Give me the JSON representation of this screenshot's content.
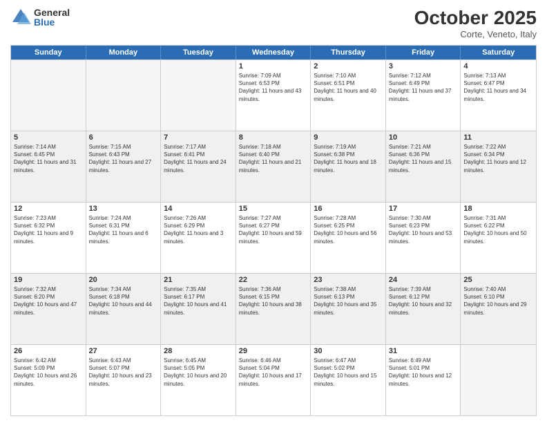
{
  "logo": {
    "general": "General",
    "blue": "Blue"
  },
  "header": {
    "month": "October 2025",
    "location": "Corte, Veneto, Italy"
  },
  "days_of_week": [
    "Sunday",
    "Monday",
    "Tuesday",
    "Wednesday",
    "Thursday",
    "Friday",
    "Saturday"
  ],
  "weeks": [
    [
      {
        "day": "",
        "sunrise": "",
        "sunset": "",
        "daylight": "",
        "empty": true
      },
      {
        "day": "",
        "sunrise": "",
        "sunset": "",
        "daylight": "",
        "empty": true
      },
      {
        "day": "",
        "sunrise": "",
        "sunset": "",
        "daylight": "",
        "empty": true
      },
      {
        "day": "1",
        "sunrise": "Sunrise: 7:09 AM",
        "sunset": "Sunset: 6:53 PM",
        "daylight": "Daylight: 11 hours and 43 minutes.",
        "empty": false
      },
      {
        "day": "2",
        "sunrise": "Sunrise: 7:10 AM",
        "sunset": "Sunset: 6:51 PM",
        "daylight": "Daylight: 11 hours and 40 minutes.",
        "empty": false
      },
      {
        "day": "3",
        "sunrise": "Sunrise: 7:12 AM",
        "sunset": "Sunset: 6:49 PM",
        "daylight": "Daylight: 11 hours and 37 minutes.",
        "empty": false
      },
      {
        "day": "4",
        "sunrise": "Sunrise: 7:13 AM",
        "sunset": "Sunset: 6:47 PM",
        "daylight": "Daylight: 11 hours and 34 minutes.",
        "empty": false
      }
    ],
    [
      {
        "day": "5",
        "sunrise": "Sunrise: 7:14 AM",
        "sunset": "Sunset: 6:45 PM",
        "daylight": "Daylight: 11 hours and 31 minutes.",
        "empty": false
      },
      {
        "day": "6",
        "sunrise": "Sunrise: 7:15 AM",
        "sunset": "Sunset: 6:43 PM",
        "daylight": "Daylight: 11 hours and 27 minutes.",
        "empty": false
      },
      {
        "day": "7",
        "sunrise": "Sunrise: 7:17 AM",
        "sunset": "Sunset: 6:41 PM",
        "daylight": "Daylight: 11 hours and 24 minutes.",
        "empty": false
      },
      {
        "day": "8",
        "sunrise": "Sunrise: 7:18 AM",
        "sunset": "Sunset: 6:40 PM",
        "daylight": "Daylight: 11 hours and 21 minutes.",
        "empty": false
      },
      {
        "day": "9",
        "sunrise": "Sunrise: 7:19 AM",
        "sunset": "Sunset: 6:38 PM",
        "daylight": "Daylight: 11 hours and 18 minutes.",
        "empty": false
      },
      {
        "day": "10",
        "sunrise": "Sunrise: 7:21 AM",
        "sunset": "Sunset: 6:36 PM",
        "daylight": "Daylight: 11 hours and 15 minutes.",
        "empty": false
      },
      {
        "day": "11",
        "sunrise": "Sunrise: 7:22 AM",
        "sunset": "Sunset: 6:34 PM",
        "daylight": "Daylight: 11 hours and 12 minutes.",
        "empty": false
      }
    ],
    [
      {
        "day": "12",
        "sunrise": "Sunrise: 7:23 AM",
        "sunset": "Sunset: 6:32 PM",
        "daylight": "Daylight: 11 hours and 9 minutes.",
        "empty": false
      },
      {
        "day": "13",
        "sunrise": "Sunrise: 7:24 AM",
        "sunset": "Sunset: 6:31 PM",
        "daylight": "Daylight: 11 hours and 6 minutes.",
        "empty": false
      },
      {
        "day": "14",
        "sunrise": "Sunrise: 7:26 AM",
        "sunset": "Sunset: 6:29 PM",
        "daylight": "Daylight: 11 hours and 3 minutes.",
        "empty": false
      },
      {
        "day": "15",
        "sunrise": "Sunrise: 7:27 AM",
        "sunset": "Sunset: 6:27 PM",
        "daylight": "Daylight: 10 hours and 59 minutes.",
        "empty": false
      },
      {
        "day": "16",
        "sunrise": "Sunrise: 7:28 AM",
        "sunset": "Sunset: 6:25 PM",
        "daylight": "Daylight: 10 hours and 56 minutes.",
        "empty": false
      },
      {
        "day": "17",
        "sunrise": "Sunrise: 7:30 AM",
        "sunset": "Sunset: 6:23 PM",
        "daylight": "Daylight: 10 hours and 53 minutes.",
        "empty": false
      },
      {
        "day": "18",
        "sunrise": "Sunrise: 7:31 AM",
        "sunset": "Sunset: 6:22 PM",
        "daylight": "Daylight: 10 hours and 50 minutes.",
        "empty": false
      }
    ],
    [
      {
        "day": "19",
        "sunrise": "Sunrise: 7:32 AM",
        "sunset": "Sunset: 6:20 PM",
        "daylight": "Daylight: 10 hours and 47 minutes.",
        "empty": false
      },
      {
        "day": "20",
        "sunrise": "Sunrise: 7:34 AM",
        "sunset": "Sunset: 6:18 PM",
        "daylight": "Daylight: 10 hours and 44 minutes.",
        "empty": false
      },
      {
        "day": "21",
        "sunrise": "Sunrise: 7:35 AM",
        "sunset": "Sunset: 6:17 PM",
        "daylight": "Daylight: 10 hours and 41 minutes.",
        "empty": false
      },
      {
        "day": "22",
        "sunrise": "Sunrise: 7:36 AM",
        "sunset": "Sunset: 6:15 PM",
        "daylight": "Daylight: 10 hours and 38 minutes.",
        "empty": false
      },
      {
        "day": "23",
        "sunrise": "Sunrise: 7:38 AM",
        "sunset": "Sunset: 6:13 PM",
        "daylight": "Daylight: 10 hours and 35 minutes.",
        "empty": false
      },
      {
        "day": "24",
        "sunrise": "Sunrise: 7:39 AM",
        "sunset": "Sunset: 6:12 PM",
        "daylight": "Daylight: 10 hours and 32 minutes.",
        "empty": false
      },
      {
        "day": "25",
        "sunrise": "Sunrise: 7:40 AM",
        "sunset": "Sunset: 6:10 PM",
        "daylight": "Daylight: 10 hours and 29 minutes.",
        "empty": false
      }
    ],
    [
      {
        "day": "26",
        "sunrise": "Sunrise: 6:42 AM",
        "sunset": "Sunset: 5:09 PM",
        "daylight": "Daylight: 10 hours and 26 minutes.",
        "empty": false
      },
      {
        "day": "27",
        "sunrise": "Sunrise: 6:43 AM",
        "sunset": "Sunset: 5:07 PM",
        "daylight": "Daylight: 10 hours and 23 minutes.",
        "empty": false
      },
      {
        "day": "28",
        "sunrise": "Sunrise: 6:45 AM",
        "sunset": "Sunset: 5:05 PM",
        "daylight": "Daylight: 10 hours and 20 minutes.",
        "empty": false
      },
      {
        "day": "29",
        "sunrise": "Sunrise: 6:46 AM",
        "sunset": "Sunset: 5:04 PM",
        "daylight": "Daylight: 10 hours and 17 minutes.",
        "empty": false
      },
      {
        "day": "30",
        "sunrise": "Sunrise: 6:47 AM",
        "sunset": "Sunset: 5:02 PM",
        "daylight": "Daylight: 10 hours and 15 minutes.",
        "empty": false
      },
      {
        "day": "31",
        "sunrise": "Sunrise: 6:49 AM",
        "sunset": "Sunset: 5:01 PM",
        "daylight": "Daylight: 10 hours and 12 minutes.",
        "empty": false
      },
      {
        "day": "",
        "sunrise": "",
        "sunset": "",
        "daylight": "",
        "empty": true
      }
    ]
  ]
}
